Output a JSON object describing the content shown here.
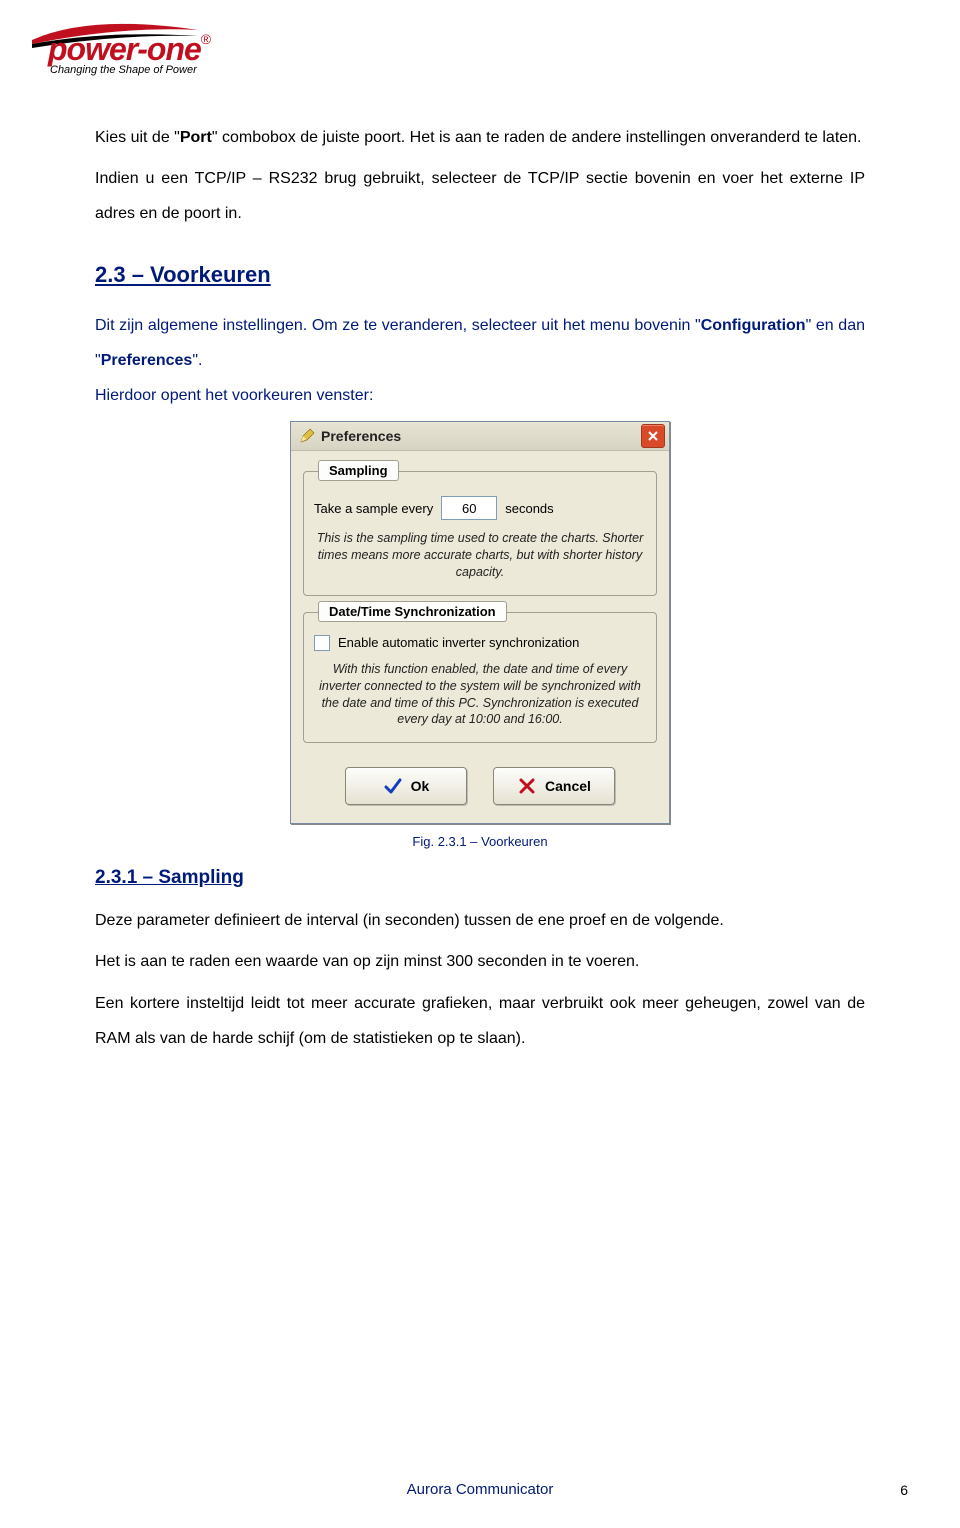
{
  "logo": {
    "main": "power-one",
    "sub": "Changing the Shape of Power",
    "reg": "®"
  },
  "p1a": "Kies uit de \"",
  "p1b": "Port",
  "p1c": "\" combobox de juiste poort. Het is aan te raden de andere instellingen onveranderd te laten.",
  "p2": "Indien u een TCP/IP – RS232 brug gebruikt, selecteer de TCP/IP sectie bovenin en voer het externe IP adres en de poort in.",
  "h23": "2.3 – Voorkeuren",
  "p3a": "Dit zijn algemene instellingen. Om ze te veranderen, selecteer uit het menu bovenin \"",
  "p3b": "Configuration",
  "p3c": "\" en dan \"",
  "p3d": "Preferences",
  "p3e": "\".",
  "p4": "Hierdoor opent het voorkeuren venster:",
  "dialog": {
    "title": "Preferences",
    "sampling": {
      "legend": "Sampling",
      "label_pre": "Take a sample every",
      "value": "60",
      "label_post": "seconds",
      "desc": "This is the sampling time used to create the charts. Shorter times means more accurate charts, but with shorter history capacity."
    },
    "dts": {
      "legend": "Date/Time Synchronization",
      "check_label": "Enable automatic inverter synchronization",
      "desc": "With this function enabled, the date and time of every inverter connected to the system will be synchronized with the date and time of this PC. Synchronization is executed every day at 10:00 and 16:00."
    },
    "ok": "Ok",
    "cancel": "Cancel"
  },
  "figcap": "Fig. 2.3.1 – Voorkeuren",
  "h231": "2.3.1 – Sampling",
  "p5": "Deze parameter definieert de interval (in seconden) tussen de ene proef en de volgende.",
  "p6": "Het is aan te raden een waarde van op zijn minst 300 seconden in te voeren.",
  "p7": "Een kortere insteltijd leidt tot meer accurate grafieken, maar verbruikt ook meer geheugen, zowel van de RAM als van de harde schijf (om de statistieken op te slaan).",
  "footer": "Aurora Communicator",
  "pagenum": "6"
}
